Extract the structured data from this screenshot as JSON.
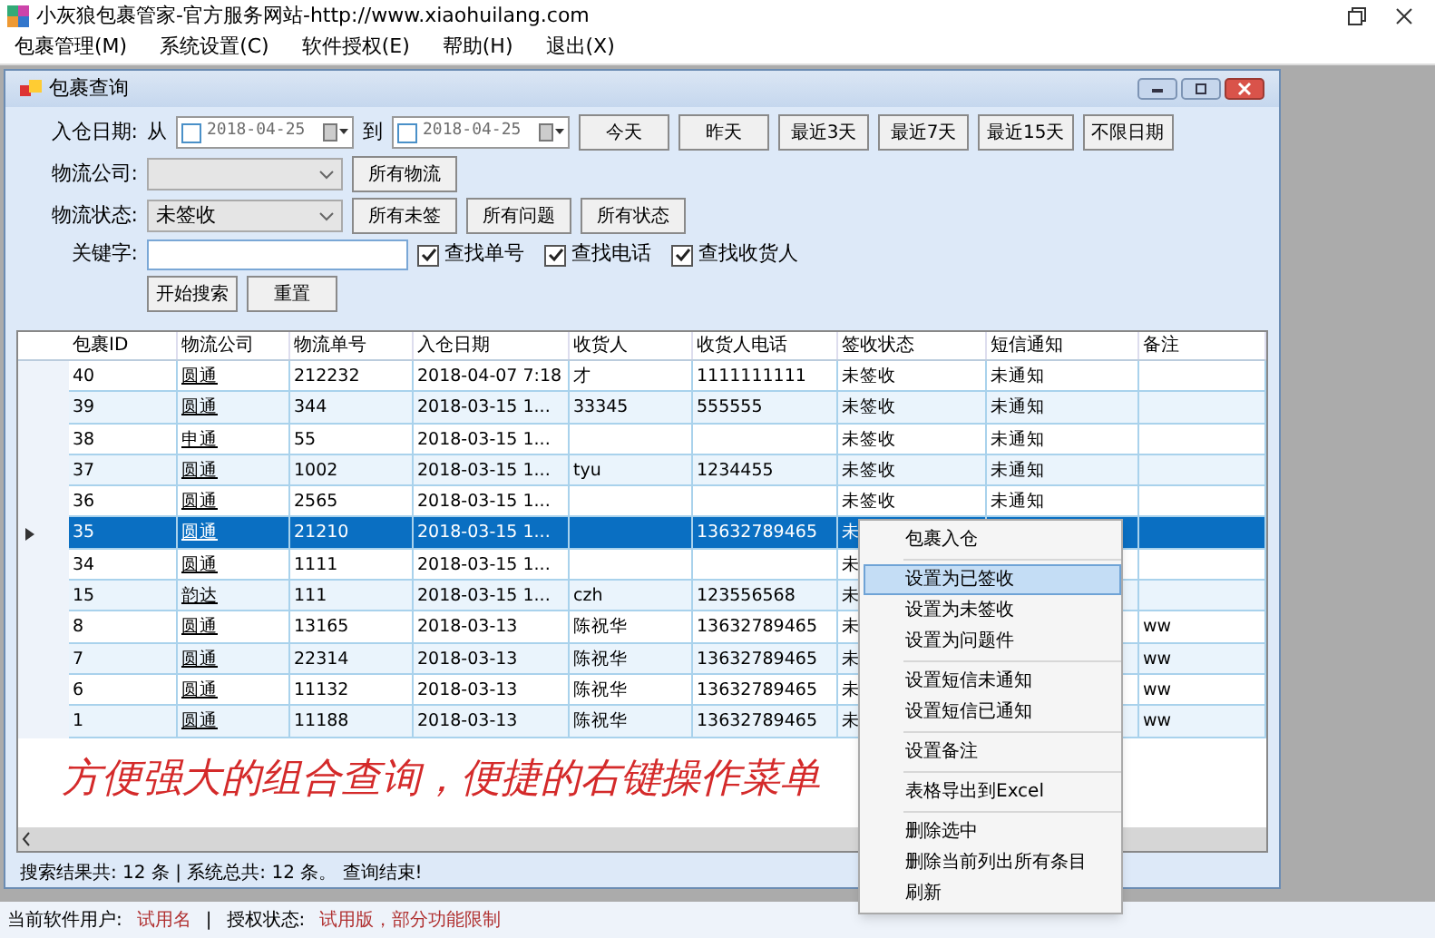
{
  "app_title": "小灰狼包裹管家-官方服务网站-http://www.xiaohuilang.com",
  "menu_bar": [
    "包裹管理(M)",
    "系统设置(C)",
    "软件授权(E)",
    "帮助(H)",
    "退出(X)"
  ],
  "child_window": {
    "title": "包裹查询"
  },
  "filters": {
    "date_label": "入仓日期:",
    "from_label": "从",
    "from_date": {
      "value": "2018-04-25",
      "checked": false
    },
    "to_label": "到",
    "to_date": {
      "value": "2018-04-25",
      "checked": false
    },
    "date_buttons": [
      "今天",
      "昨天",
      "最近3天",
      "最近7天",
      "最近15天",
      "不限日期"
    ],
    "company_label": "物流公司:",
    "company_buttons": [
      "所有物流"
    ],
    "status_label": "物流状态:",
    "status_value": "未签收",
    "status_buttons": [
      "所有未签",
      "所有问题",
      "所有状态"
    ],
    "keyword_label": "关键字:",
    "options": [
      {
        "label": "查找单号",
        "checked": true
      },
      {
        "label": "查找电话",
        "checked": true
      },
      {
        "label": "查找收货人",
        "checked": true
      }
    ],
    "actions": [
      "开始搜索",
      "重置"
    ]
  },
  "table": {
    "columns": [
      "包裹ID",
      "物流公司",
      "物流单号",
      "入仓日期",
      "收货人",
      "收货人电话",
      "签收状态",
      "短信通知",
      "备注"
    ],
    "rows": [
      {
        "selected": false,
        "cells": [
          "40",
          "圆通",
          "212232",
          "2018-04-07 7:18",
          "才",
          "1111111111",
          "未签收",
          "未通知",
          ""
        ]
      },
      {
        "selected": false,
        "cells": [
          "39",
          "圆通",
          "344",
          "2018-03-15 1...",
          "33345",
          "555555",
          "未签收",
          "未通知",
          ""
        ]
      },
      {
        "selected": false,
        "cells": [
          "38",
          "申通",
          "55",
          "2018-03-15 1...",
          "",
          "",
          "未签收",
          "未通知",
          ""
        ]
      },
      {
        "selected": false,
        "cells": [
          "37",
          "圆通",
          "1002",
          "2018-03-15 1...",
          "tyu",
          "1234455",
          "未签收",
          "未通知",
          ""
        ]
      },
      {
        "selected": false,
        "cells": [
          "36",
          "圆通",
          "2565",
          "2018-03-15 1...",
          "",
          "",
          "未签收",
          "未通知",
          ""
        ]
      },
      {
        "selected": true,
        "cells": [
          "35",
          "圆通",
          "21210",
          "2018-03-15 1...",
          "",
          "13632789465",
          "未",
          "",
          ""
        ]
      },
      {
        "selected": false,
        "cells": [
          "34",
          "圆通",
          "1111",
          "2018-03-15 1...",
          "",
          "",
          "未",
          "",
          ""
        ]
      },
      {
        "selected": false,
        "cells": [
          "15",
          "韵达",
          "111",
          "2018-03-15 1...",
          "czh",
          "123556568",
          "未",
          "",
          ""
        ]
      },
      {
        "selected": false,
        "cells": [
          "8",
          "圆通",
          "13165",
          "2018-03-13",
          "陈祝华",
          "13632789465",
          "未",
          "",
          "ww"
        ]
      },
      {
        "selected": false,
        "cells": [
          "7",
          "圆通",
          "22314",
          "2018-03-13",
          "陈祝华",
          "13632789465",
          "未",
          "",
          "ww"
        ]
      },
      {
        "selected": false,
        "cells": [
          "6",
          "圆通",
          "11132",
          "2018-03-13",
          "陈祝华",
          "13632789465",
          "未",
          "",
          "ww"
        ]
      },
      {
        "selected": false,
        "cells": [
          "1",
          "圆通",
          "11188",
          "2018-03-13",
          "陈祝华",
          "13632789465",
          "未",
          "",
          "ww"
        ]
      }
    ]
  },
  "caption": "方便强大的组合查询，便捷的右键操作菜单",
  "context_menu": {
    "groups": [
      [
        {
          "label": "包裹入仓",
          "selected": false
        }
      ],
      [
        {
          "label": "设置为已签收",
          "selected": true
        },
        {
          "label": "设置为未签收",
          "selected": false
        },
        {
          "label": "设置为问题件",
          "selected": false
        }
      ],
      [
        {
          "label": "设置短信未通知",
          "selected": false
        },
        {
          "label": "设置短信已通知",
          "selected": false
        }
      ],
      [
        {
          "label": "设置备注",
          "selected": false
        }
      ],
      [
        {
          "label": "表格导出到Excel",
          "selected": false
        }
      ],
      [
        {
          "label": "删除选中",
          "selected": false
        },
        {
          "label": "删除当前列出所有条目",
          "selected": false
        },
        {
          "label": "刷新",
          "selected": false
        }
      ]
    ]
  },
  "child_status": "搜索结果共: 12 条 | 系统总共: 12 条。 查询结束!",
  "status_bar": {
    "user_label": "当前软件用户:",
    "user_value": "试用名",
    "separator": "|",
    "license_label": "授权状态:",
    "license_value": "试用版，部分功能限制"
  }
}
